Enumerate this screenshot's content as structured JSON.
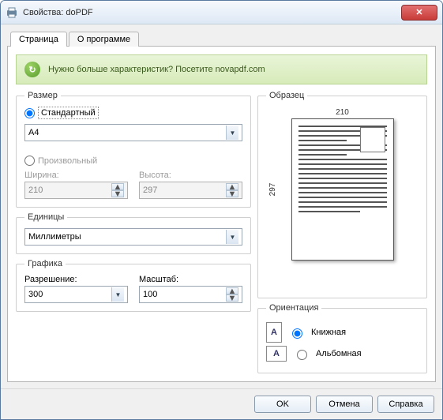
{
  "window": {
    "title": "Свойства: doPDF"
  },
  "tabs": {
    "page": "Страница",
    "about": "О программе"
  },
  "banner": {
    "text": "Нужно больше характеристик? Посетите novapdf.com"
  },
  "size": {
    "legend": "Размер",
    "standard_label": "Стандартный",
    "paper": "A4",
    "custom_label": "Произвольный",
    "width_label": "Ширина:",
    "height_label": "Высота:",
    "width_value": "210",
    "height_value": "297"
  },
  "units": {
    "legend": "Единицы",
    "value": "Миллиметры"
  },
  "graphics": {
    "legend": "Графика",
    "resolution_label": "Разрешение:",
    "scale_label": "Масштаб:",
    "resolution_value": "300",
    "scale_value": "100"
  },
  "preview": {
    "legend": "Образец",
    "width": "210",
    "height": "297"
  },
  "orientation": {
    "legend": "Ориентация",
    "portrait": "Книжная",
    "landscape": "Альбомная"
  },
  "buttons": {
    "ok": "OK",
    "cancel": "Отмена",
    "help": "Справка"
  }
}
